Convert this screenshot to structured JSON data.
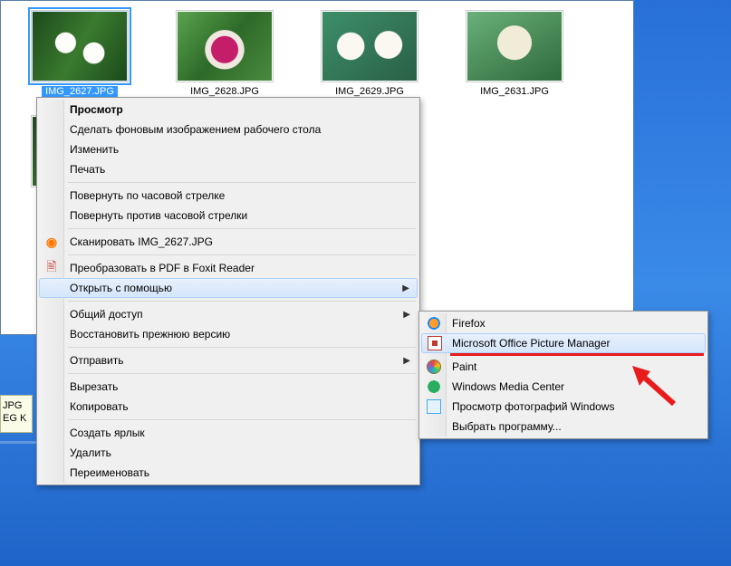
{
  "thumbnails": [
    {
      "label": "IMG_2627.JPG",
      "selected": true,
      "variant": "green-white"
    },
    {
      "label": "IMG_2628.JPG",
      "selected": false,
      "variant": "pink"
    },
    {
      "label": "IMG_2629.JPG",
      "selected": false,
      "variant": "white-big"
    },
    {
      "label": "IMG_2631.JPG",
      "selected": false,
      "variant": "cream"
    }
  ],
  "second_row_variant": "dark",
  "tooltip": {
    "line1": "JPG",
    "line2": "EG   K"
  },
  "context_menu": {
    "view": "Просмотр",
    "set_wallpaper": "Сделать фоновым изображением рабочего стола",
    "edit": "Изменить",
    "print": "Печать",
    "rotate_cw": "Повернуть по часовой стрелке",
    "rotate_ccw": "Повернуть против часовой стрелки",
    "scan": "Сканировать IMG_2627.JPG",
    "convert_pdf": "Преобразовать в PDF в Foxit Reader",
    "open_with": "Открыть с помощью",
    "share": "Общий доступ",
    "restore": "Восстановить прежнюю версию",
    "send_to": "Отправить",
    "cut": "Вырезать",
    "copy": "Копировать",
    "create_shortcut": "Создать ярлык",
    "delete": "Удалить",
    "rename": "Переименовать"
  },
  "submenu": {
    "firefox": "Firefox",
    "mopm": "Microsoft Office Picture Manager",
    "paint": "Paint",
    "wmc": "Windows Media Center",
    "photoviewer": "Просмотр фотографий Windows",
    "choose": "Выбрать программу..."
  }
}
